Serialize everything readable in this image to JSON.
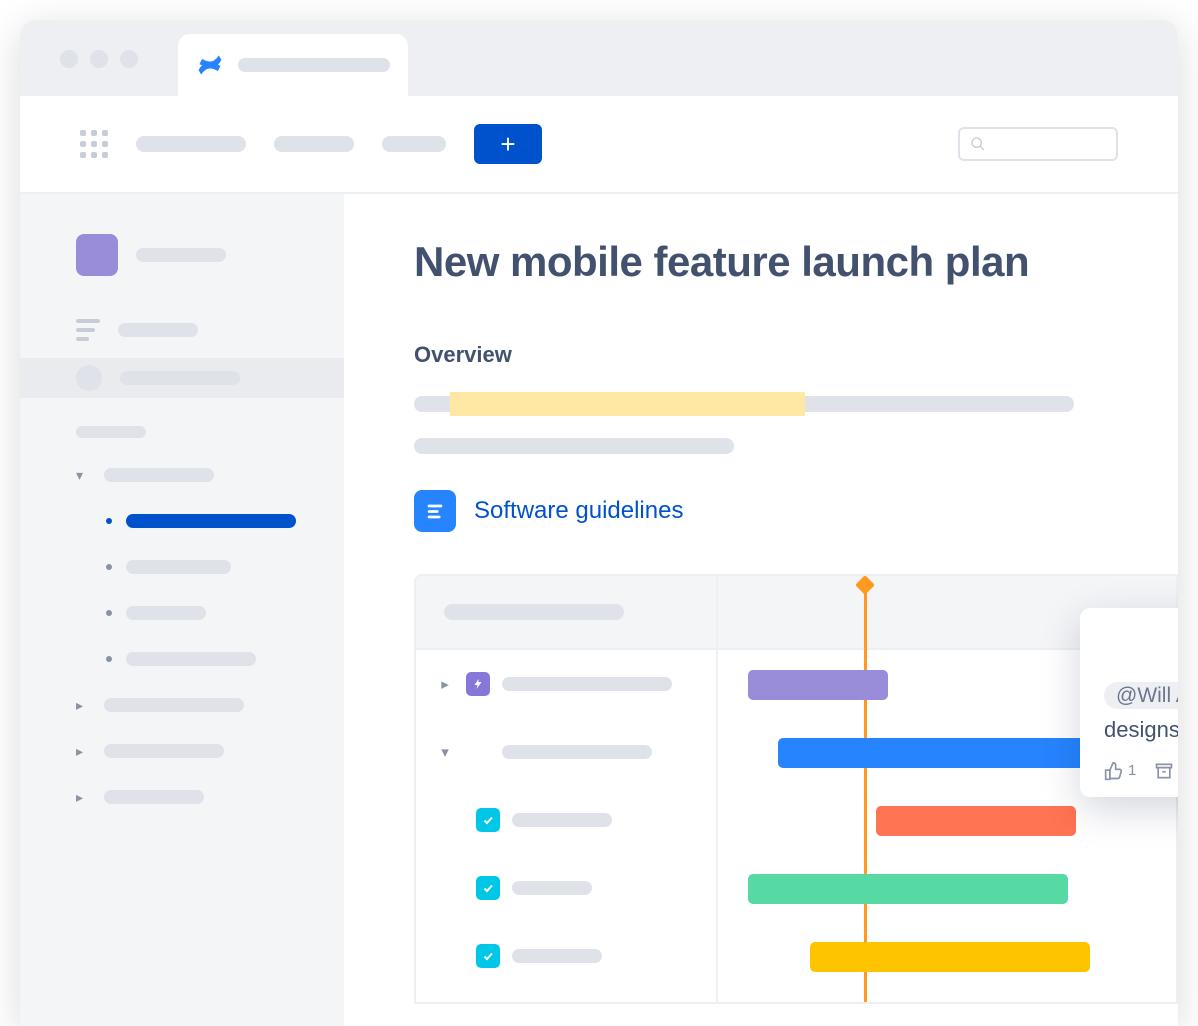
{
  "page": {
    "title": "New mobile feature launch plan"
  },
  "section": {
    "overview_title": "Overview"
  },
  "doc_link": {
    "label": "Software guidelines"
  },
  "comment": {
    "mention": "@Will Allen",
    "text": "Can you share the designs?",
    "like_count": "1"
  },
  "colors": {
    "primary": "#0052cc",
    "epic": "#8777d9",
    "task": "#00c7e6",
    "bar_purple": "#998dd9",
    "bar_blue": "#2684ff",
    "bar_orange": "#ff7452",
    "bar_green": "#57d9a3",
    "bar_yellow": "#ffc400",
    "today": "#ff991f"
  }
}
